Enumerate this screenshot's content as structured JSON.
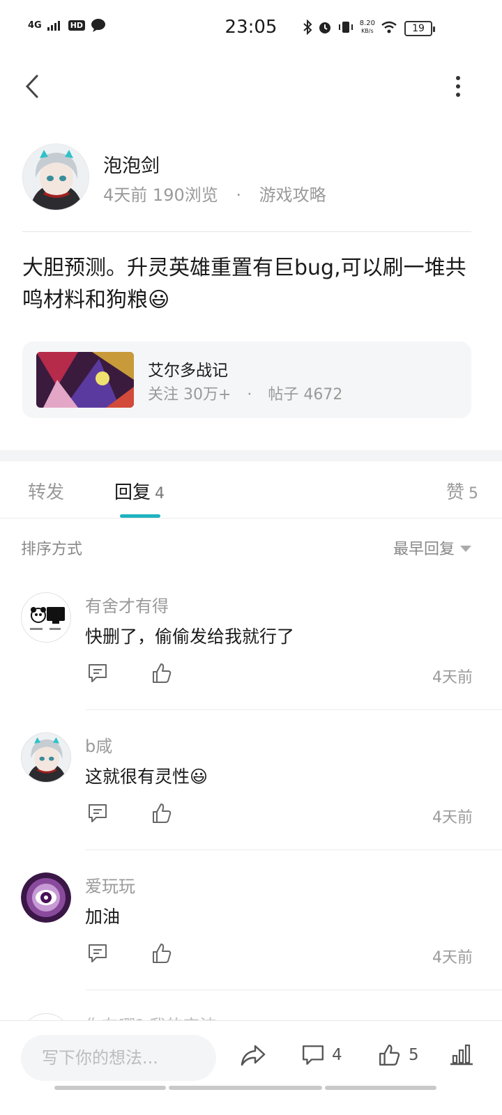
{
  "status_bar": {
    "network": "4G",
    "hd": "HD",
    "time": "23:05",
    "speed_value": "8.20",
    "speed_unit": "KB/s",
    "battery": "19"
  },
  "post": {
    "author": "泡泡剑",
    "time_ago": "4天前",
    "views": "190浏览",
    "separator": "·",
    "category": "游戏攻略",
    "text": "大胆预测。升灵英雄重置有巨bug,可以刷一堆共鸣材料和狗粮😃"
  },
  "forum": {
    "name": "艾尔多战记",
    "followers": "关注 30万+",
    "separator": "·",
    "posts": "帖子 4672"
  },
  "tabs": {
    "forward": "转发",
    "reply_label": "回复",
    "reply_count": "4",
    "like_label": "赞",
    "like_count": "5"
  },
  "sort": {
    "label": "排序方式",
    "value": "最早回复"
  },
  "comments": [
    {
      "user": "有舍才有得",
      "text": "快删了，偷偷发给我就行了",
      "time": "4天前"
    },
    {
      "user": "b咸",
      "text": "这就很有灵性😃",
      "time": "4天前"
    },
    {
      "user": "爱玩玩",
      "text": "加油",
      "time": "4天前"
    }
  ],
  "partial_comment_text": "你在哪? 我的宝波",
  "bottom_bar": {
    "compose_placeholder": "写下你的想法...",
    "comment_count": "4",
    "like_count": "5"
  },
  "colors": {
    "accent": "#1fb3c0",
    "text_primary": "#1a1a1a",
    "text_secondary": "#9a9a9a"
  }
}
